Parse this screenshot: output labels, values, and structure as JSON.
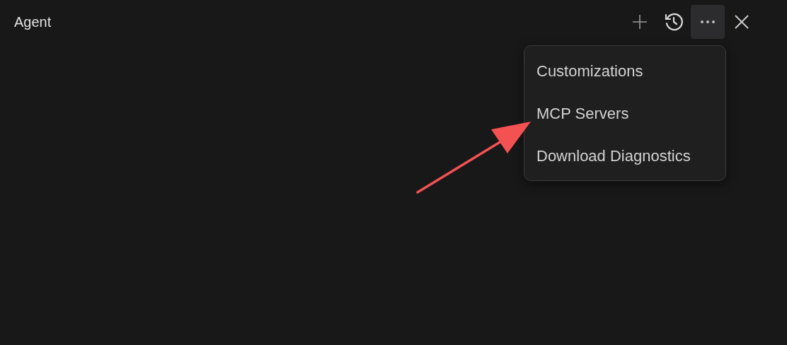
{
  "panel": {
    "title": "Agent"
  },
  "toolbar": [
    {
      "kind": "plus",
      "selected": false
    },
    {
      "kind": "history",
      "selected": false
    },
    {
      "kind": "more",
      "selected": true
    },
    {
      "kind": "close",
      "selected": false
    }
  ],
  "menu": {
    "items": [
      {
        "label": "Customizations"
      },
      {
        "label": "MCP Servers"
      },
      {
        "label": "Download Diagnostics"
      }
    ]
  },
  "annotation": {
    "kind": "arrow"
  }
}
